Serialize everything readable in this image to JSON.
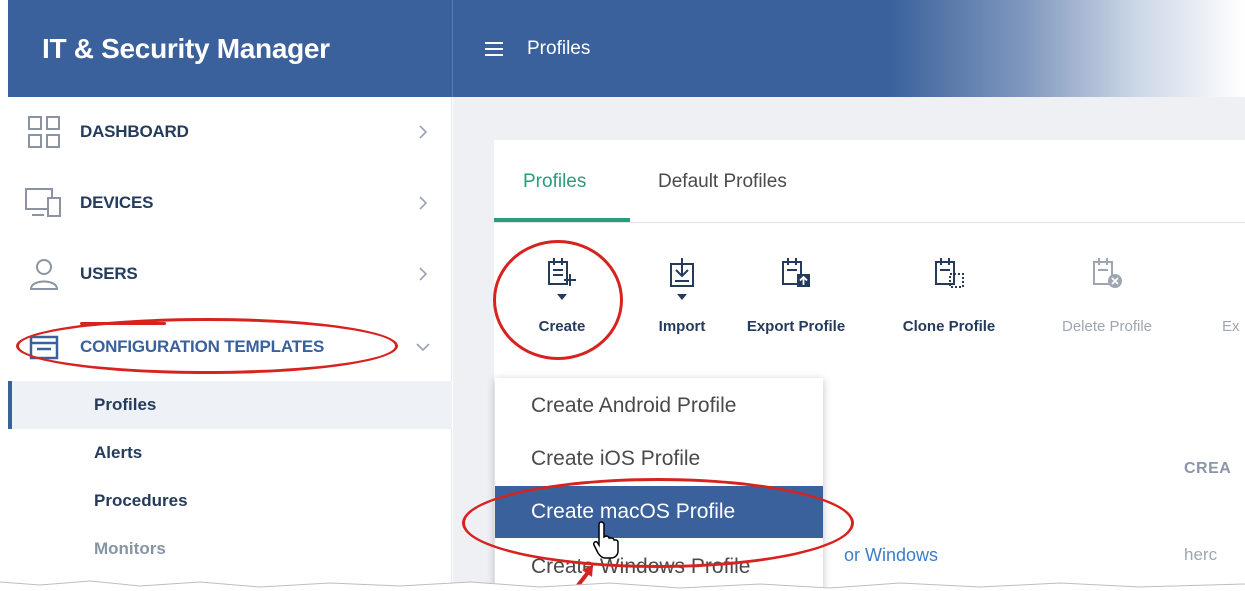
{
  "header": {
    "app_title": "IT & Security Manager",
    "page_title": "Profiles"
  },
  "sidebar": {
    "items": [
      {
        "label": "DASHBOARD",
        "icon": "dashboard-grid-icon"
      },
      {
        "label": "DEVICES",
        "icon": "devices-icon"
      },
      {
        "label": "USERS",
        "icon": "user-icon"
      },
      {
        "label": "CONFIGURATION TEMPLATES",
        "icon": "templates-icon",
        "expanded": true
      }
    ],
    "subitems": [
      {
        "label": "Profiles",
        "active": true
      },
      {
        "label": "Alerts"
      },
      {
        "label": "Procedures"
      },
      {
        "label": "Monitors"
      }
    ]
  },
  "tabs": [
    {
      "label": "Profiles",
      "active": true
    },
    {
      "label": "Default Profiles"
    }
  ],
  "toolbar": {
    "create": "Create",
    "import": "Import",
    "export": "Export Profile",
    "clone": "Clone Profile",
    "delete": "Delete Profile",
    "partial": "Ex"
  },
  "table": {
    "column_header_partial": "CREA",
    "row_link_partial": "or Windows",
    "row_cell_partial": "herc"
  },
  "create_menu": {
    "items": [
      "Create Android Profile",
      "Create iOS Profile",
      "Create macOS Profile",
      "Create Windows Profile"
    ],
    "selected_index": 2
  },
  "colors": {
    "brand_blue": "#3a619c",
    "accent_green": "#2a9b7b",
    "annotation_red": "#d7231f",
    "nav_text": "#253b5c",
    "link_blue": "#3a7ec9"
  }
}
